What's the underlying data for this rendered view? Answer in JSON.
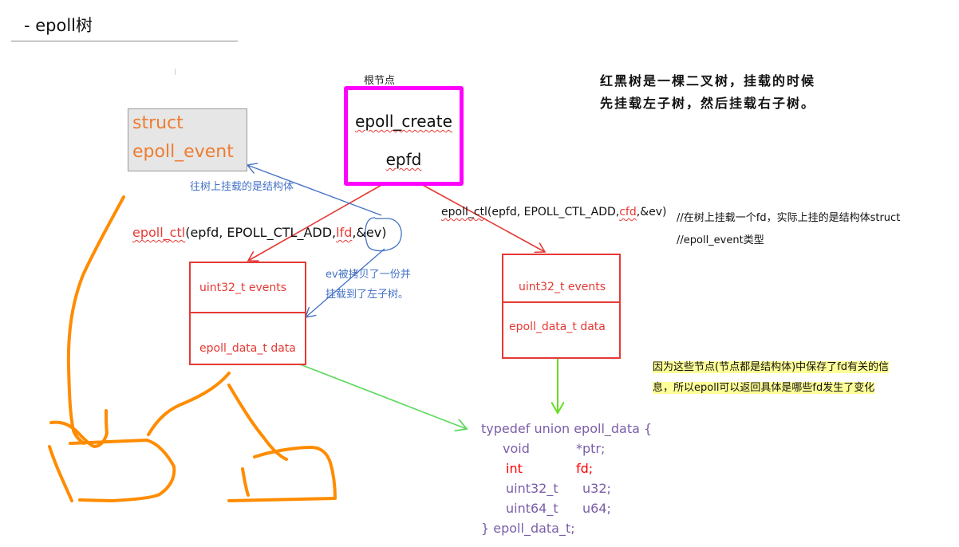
{
  "heading": {
    "text": "- epoll树"
  },
  "cursor_glyph": "I",
  "tree_note": {
    "line1": "红黑树是一棵二叉树，挂载的时候",
    "line2": "先挂载左子树，然后挂载右子树。"
  },
  "root_node": {
    "label": "根节点",
    "function": "epoll_create",
    "return_value": "epfd"
  },
  "struct_box": {
    "line1": "struct",
    "line2": "epoll_event"
  },
  "annotations": {
    "mount_struct": "往树上挂载的是结构体",
    "copy_line1": "ev被拷贝了一份并",
    "copy_line2": "挂载到了左子树。"
  },
  "calls": {
    "left": {
      "fn": "epoll_ctl",
      "args_prefix": "(epfd, EPOLL_CTL_ADD,",
      "fd": "lfd",
      "args_suffix": ",&ev)"
    },
    "right": {
      "fn": "epoll_ctl",
      "args_prefix": "(epfd, EPOLL_CTL_ADD,",
      "fd": "cfd",
      "args_suffix": ",&ev)"
    }
  },
  "comments": {
    "line1": "//在树上挂载一个fd，实际上挂的是结构体struct",
    "line2": "//epoll_event类型"
  },
  "nodes": {
    "left": {
      "field1": "uint32_t  events",
      "field2": "epoll_data_t data"
    },
    "right": {
      "field1": "uint32_t  events",
      "field2": "epoll_data_t data"
    }
  },
  "highlight_note": {
    "line1": "因为这些节点(节点都是结构体)中保存了fd有关的信",
    "line2": "息，所以epoll可以返回具体是哪些fd发生了变化"
  },
  "code": {
    "open": "typedef union epoll_data {",
    "members": [
      {
        "type": "void",
        "name": "*ptr;",
        "highlight": false
      },
      {
        "type": "int",
        "name": "fd;",
        "highlight": true
      },
      {
        "type": "uint32_t",
        "name": "u32;",
        "highlight": false
      },
      {
        "type": "uint64_t",
        "name": "u64;",
        "highlight": false
      }
    ],
    "close": "} epoll_data_t;"
  },
  "colors": {
    "root_border": "#ff00ff",
    "node_red": "#e53935",
    "annotation_blue": "#4472c4",
    "struct_orange": "#ed7d31",
    "arrow_green": "#5ad95a",
    "arrow_lime": "#66dd22",
    "code_purple": "#7a5ea8",
    "highlight_yellow": "#ffff99",
    "sketch_orange": "#ff8c00"
  }
}
